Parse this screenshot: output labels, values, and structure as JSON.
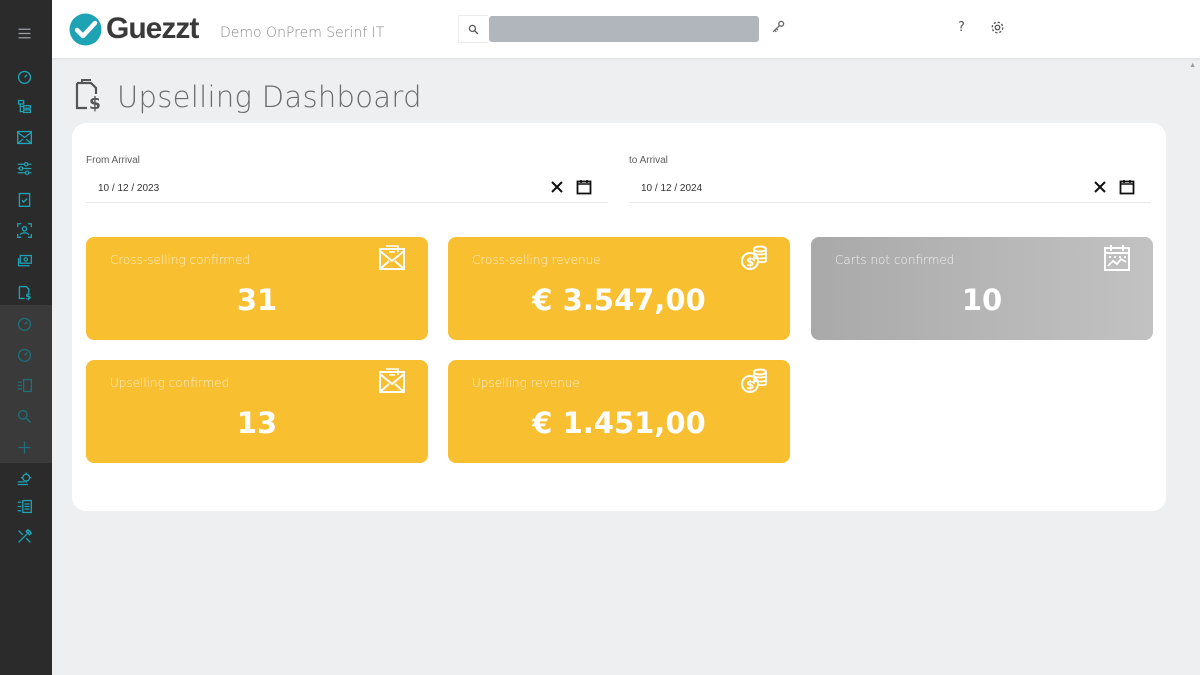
{
  "app": {
    "brand": "Guezzt",
    "org_name": "Demo OnPrem Serinf IT",
    "accent_color": "#1ea3b5",
    "help_label": "?"
  },
  "search": {
    "placeholder": ""
  },
  "page": {
    "title": "Upselling Dashboard"
  },
  "filters": {
    "from": {
      "label": "From Arrival",
      "value": "10 / 12 / 2023"
    },
    "to": {
      "label": "to Arrival",
      "value": "10 / 12 / 2024"
    }
  },
  "tiles": [
    {
      "label": "Cross-selling confirmed",
      "value": "31",
      "icon": "envelope-icon",
      "color": "#f8bf31"
    },
    {
      "label": "Cross-selling revenue",
      "value": "€ 3.547,00",
      "icon": "coins-icon",
      "color": "#f8bf31"
    },
    {
      "label": "Carts not confirmed",
      "value": "10",
      "icon": "calendar-chart-icon",
      "color": "#b5b5b5"
    },
    {
      "label": "Upselling confirmed",
      "value": "13",
      "icon": "envelope-icon",
      "color": "#f8bf31"
    },
    {
      "label": "Upselling revenue",
      "value": "€ 1.451,00",
      "icon": "coins-icon",
      "color": "#f8bf31"
    }
  ],
  "sidebar": {
    "items": [
      {
        "name": "speedometer-icon"
      },
      {
        "name": "hierarchy-icon"
      },
      {
        "name": "mail-image-icon"
      },
      {
        "name": "sliders-icon"
      },
      {
        "name": "clipboard-check-icon"
      },
      {
        "name": "face-scan-icon"
      },
      {
        "name": "money-stack-icon"
      },
      {
        "name": "file-dollar-icon"
      },
      {
        "name": "gauge-icon"
      },
      {
        "name": "gauge-icon-2"
      },
      {
        "name": "flow-icon"
      },
      {
        "name": "search-icon"
      },
      {
        "name": "plus-icon"
      },
      {
        "name": "gear-flow-icon"
      },
      {
        "name": "flow-list-icon"
      },
      {
        "name": "tools-icon"
      }
    ]
  }
}
